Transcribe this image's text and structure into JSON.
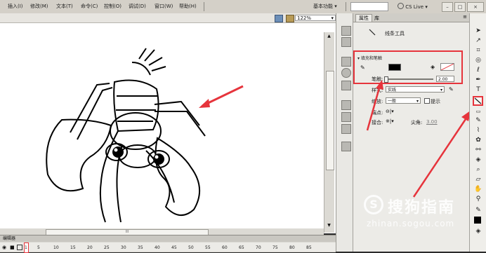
{
  "menubar": {
    "items": [
      "插入(I)",
      "修改(M)",
      "文本(T)",
      "命令(C)",
      "控制(O)",
      "调试(D)",
      "窗口(W)",
      "帮助(H)"
    ],
    "workspace": "基本功能",
    "cs_live": "CS Live",
    "window_min": "–",
    "window_max": "□",
    "window_close": "×"
  },
  "stage": {
    "zoom": "122%",
    "scroll_grip": "III"
  },
  "timeline": {
    "tab_label": "编辑器",
    "frames": [
      "1",
      "5",
      "10",
      "15",
      "20",
      "25",
      "30",
      "35",
      "40",
      "45",
      "50",
      "55",
      "60",
      "65",
      "70",
      "75",
      "80",
      "85"
    ]
  },
  "properties": {
    "tab_properties": "属性",
    "tab_library": "库",
    "tool_name": "线条工具",
    "section_fill_stroke": "填充和笔触",
    "stroke_label": "笔触:",
    "stroke_value": "2.00",
    "style_label": "样式:",
    "style_value": "实线",
    "scale_label": "缩放:",
    "scale_value": "一般",
    "hint_label": "提示",
    "cap_label": "端点:",
    "join_label": "接合:",
    "miter_label": "尖角:",
    "miter_value": "3.00",
    "stroke_color": "#000000"
  },
  "watermark": {
    "brand": "搜狗指南",
    "url": "zhinan.sogou.com"
  },
  "colors": {
    "annotation": "#e6343c",
    "highlight_tool": "#e6343c"
  }
}
